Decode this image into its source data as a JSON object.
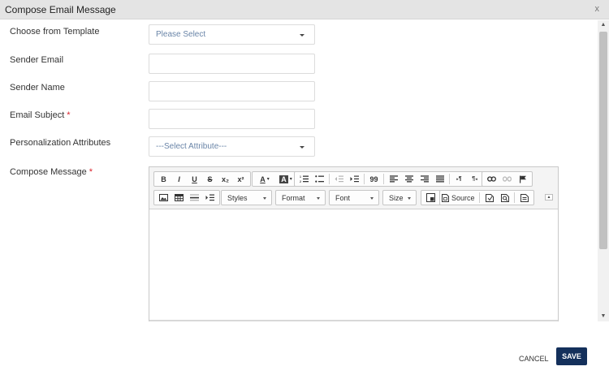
{
  "dialog": {
    "title": "Compose Email Message",
    "close_label": "x"
  },
  "form": {
    "template": {
      "label": "Choose from Template",
      "value": "Please Select"
    },
    "sender_email": {
      "label": "Sender Email",
      "value": ""
    },
    "sender_name": {
      "label": "Sender Name",
      "value": ""
    },
    "subject": {
      "label": "Email Subject",
      "required_mark": "*",
      "value": ""
    },
    "personalization": {
      "label": "Personalization Attributes",
      "value": "---Select Attribute---"
    },
    "message": {
      "label": "Compose Message",
      "required_mark": "*"
    }
  },
  "editor": {
    "bold": "B",
    "italic": "I",
    "underline": "U",
    "strike": "S",
    "subscript": "x₂",
    "superscript": "x²",
    "text_color": "A",
    "bg_color": "A",
    "blockquote": "99",
    "ltr": "¶",
    "rtl": "¶",
    "styles": "Styles",
    "format": "Format",
    "font": "Font",
    "size": "Size",
    "source": "Source",
    "content": ""
  },
  "footer": {
    "cancel": "CANCEL",
    "save": "SAVE"
  },
  "colors": {
    "accent": "#14305b",
    "required": "#d9232d",
    "placeholder": "#6a85a8"
  }
}
